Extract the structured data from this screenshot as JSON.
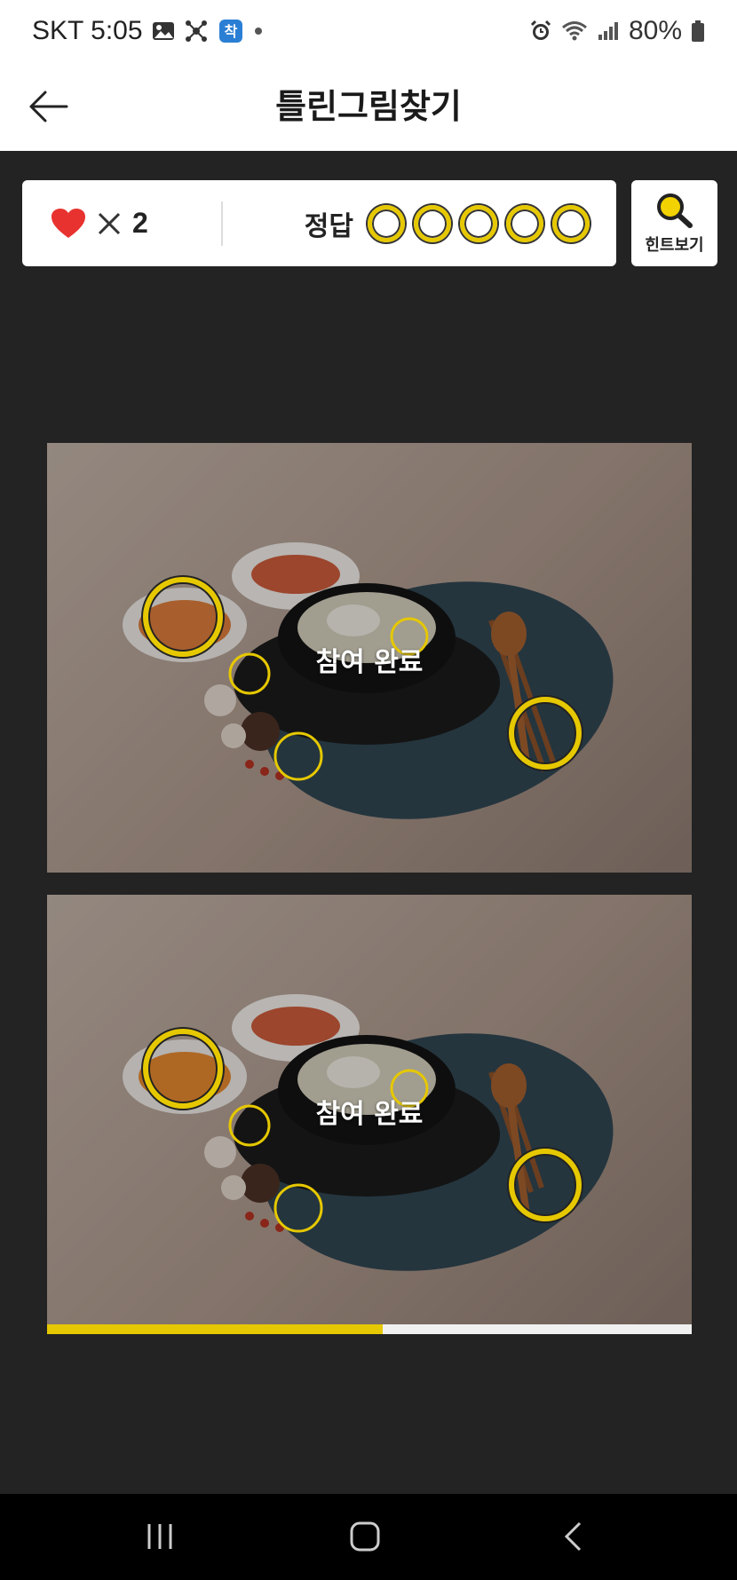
{
  "status_bar": {
    "carrier_time": "SKT 5:05",
    "battery": "80%",
    "icons_left": [
      "gallery-icon",
      "network-icon",
      "app-notification-icon",
      "dot-icon"
    ],
    "icons_right": [
      "alarm-icon",
      "wifi-icon",
      "signal-icon",
      "battery-icon"
    ]
  },
  "app_bar": {
    "title": "틀린그림찾기",
    "back_icon": "back-arrow-icon"
  },
  "game_status": {
    "lives_icon": "heart-icon",
    "lives_multiplier": "×",
    "lives_count": "2",
    "answers_label": "정답",
    "answers_total": 5,
    "answers_found": 0,
    "hint_label": "힌트보기",
    "hint_icon": "magnifier-icon"
  },
  "puzzle": {
    "overlay_text": "참여 완료",
    "images": [
      "original-photo",
      "modified-photo"
    ],
    "progress_fraction": 0.52
  },
  "nav_bar": {
    "recents_icon": "recents-icon",
    "home_icon": "home-icon",
    "back_icon": "back-chevron-icon"
  },
  "colors": {
    "accent": "#e6c800",
    "heart": "#e8322f",
    "background": "#232323",
    "panel": "#ffffff"
  }
}
